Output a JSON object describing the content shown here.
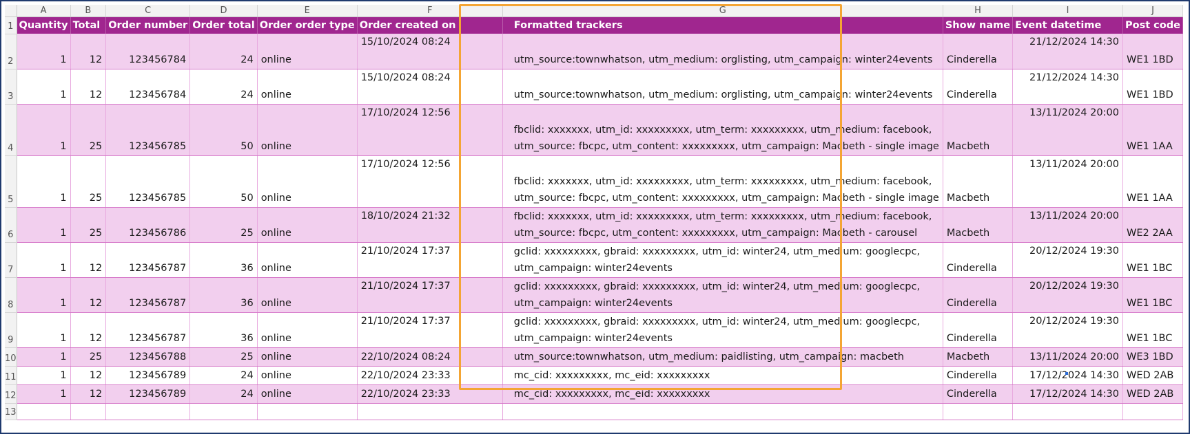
{
  "columns": [
    "A",
    "B",
    "C",
    "D",
    "E",
    "F",
    "G",
    "H",
    "I",
    "J"
  ],
  "headers": {
    "quantity": "Quantity",
    "total": "Total",
    "order_number": "Order number",
    "order_total": "Order total",
    "order_type": "Order order type",
    "order_created": "Order created on",
    "formatted_trackers": "Formatted trackers",
    "show_name": "Show name",
    "event_datetime": "Event datetime",
    "post_code": "Post code"
  },
  "row_numbers": [
    "1",
    "2",
    "3",
    "4",
    "5",
    "6",
    "7",
    "8",
    "9",
    "10",
    "11",
    "12",
    "13"
  ],
  "rows": [
    {
      "qty": "1",
      "total": "12",
      "order_no": "123456784",
      "order_total": "24",
      "type": "online",
      "created": "15/10/2024 08:24",
      "trackers": [
        "",
        "utm_source:townwhatson, utm_medium: orglisting, utm_campaign: winter24events"
      ],
      "show": "Cinderella",
      "event": "21/12/2024 14:30",
      "post": "WE1 1BD"
    },
    {
      "qty": "1",
      "total": "12",
      "order_no": "123456784",
      "order_total": "24",
      "type": "online",
      "created": "15/10/2024 08:24",
      "trackers": [
        "",
        "utm_source:townwhatson, utm_medium: orglisting, utm_campaign: winter24events"
      ],
      "show": "Cinderella",
      "event": "21/12/2024 14:30",
      "post": "WE1 1BD"
    },
    {
      "qty": "1",
      "total": "25",
      "order_no": "123456785",
      "order_total": "50",
      "type": "online",
      "created": "17/10/2024 12:56",
      "trackers": [
        "",
        "fbclid: xxxxxxx, utm_id: xxxxxxxxx, utm_term: xxxxxxxxx, utm_medium: facebook,",
        "utm_source: fbcpc, utm_content: xxxxxxxxx, utm_campaign: Macbeth - single image"
      ],
      "show": "Macbeth",
      "event": "13/11/2024 20:00",
      "post": "WE1 1AA"
    },
    {
      "qty": "1",
      "total": "25",
      "order_no": "123456785",
      "order_total": "50",
      "type": "online",
      "created": "17/10/2024 12:56",
      "trackers": [
        "",
        "fbclid: xxxxxxx, utm_id: xxxxxxxxx, utm_term: xxxxxxxxx, utm_medium: facebook,",
        "utm_source: fbcpc, utm_content: xxxxxxxxx, utm_campaign: Macbeth - single image"
      ],
      "show": "Macbeth",
      "event": "13/11/2024 20:00",
      "post": "WE1 1AA"
    },
    {
      "qty": "1",
      "total": "25",
      "order_no": "123456786",
      "order_total": "25",
      "type": "online",
      "created": "18/10/2024 21:32",
      "trackers": [
        "fbclid: xxxxxxx, utm_id: xxxxxxxxx, utm_term: xxxxxxxxx, utm_medium: facebook,",
        "utm_source: fbcpc, utm_content: xxxxxxxxx, utm_campaign: Macbeth - carousel"
      ],
      "show": "Macbeth",
      "event": "13/11/2024 20:00",
      "post": "WE2 2AA"
    },
    {
      "qty": "1",
      "total": "12",
      "order_no": "123456787",
      "order_total": "36",
      "type": "online",
      "created": "21/10/2024 17:37",
      "trackers": [
        "gclid: xxxxxxxxx, gbraid: xxxxxxxxx, utm_id: winter24, utm_medium: googlecpc,",
        "utm_campaign: winter24events"
      ],
      "show": "Cinderella",
      "event": "20/12/2024 19:30",
      "post": "WE1 1BC"
    },
    {
      "qty": "1",
      "total": "12",
      "order_no": "123456787",
      "order_total": "36",
      "type": "online",
      "created": "21/10/2024 17:37",
      "trackers": [
        "gclid: xxxxxxxxx, gbraid: xxxxxxxxx, utm_id: winter24, utm_medium: googlecpc,",
        "utm_campaign: winter24events"
      ],
      "show": "Cinderella",
      "event": "20/12/2024 19:30",
      "post": "WE1 1BC"
    },
    {
      "qty": "1",
      "total": "12",
      "order_no": "123456787",
      "order_total": "36",
      "type": "online",
      "created": "21/10/2024 17:37",
      "trackers": [
        "gclid: xxxxxxxxx, gbraid: xxxxxxxxx, utm_id: winter24, utm_medium: googlecpc,",
        "utm_campaign: winter24events"
      ],
      "show": "Cinderella",
      "event": "20/12/2024 19:30",
      "post": "WE1 1BC"
    },
    {
      "qty": "1",
      "total": "25",
      "order_no": "123456788",
      "order_total": "25",
      "type": "online",
      "created": "22/10/2024 08:24",
      "trackers": [
        "utm_source:townwhatson, utm_medium: paidlisting, utm_campaign: macbeth"
      ],
      "show": "Macbeth",
      "event": "13/11/2024 20:00",
      "post": "WE3 1BD"
    },
    {
      "qty": "1",
      "total": "12",
      "order_no": "123456789",
      "order_total": "24",
      "type": "online",
      "created": "22/10/2024 23:33",
      "trackers": [
        "mc_cid: xxxxxxxxx, mc_eid: xxxxxxxxx"
      ],
      "show": "Cinderella",
      "event": "17/12/2024 14:30",
      "post": "WED 2AB"
    },
    {
      "qty": "1",
      "total": "12",
      "order_no": "123456789",
      "order_total": "24",
      "type": "online",
      "created": "22/10/2024 23:33",
      "trackers": [
        "mc_cid: xxxxxxxxx, mc_eid: xxxxxxxxx"
      ],
      "show": "Cinderella",
      "event": "17/12/2024 14:30",
      "post": "WED 2AB"
    }
  ],
  "colors": {
    "header_bg": "#a0268f",
    "row_pink": "#f2cfee",
    "highlight": "#f4a534",
    "frame": "#1f3a6e"
  }
}
